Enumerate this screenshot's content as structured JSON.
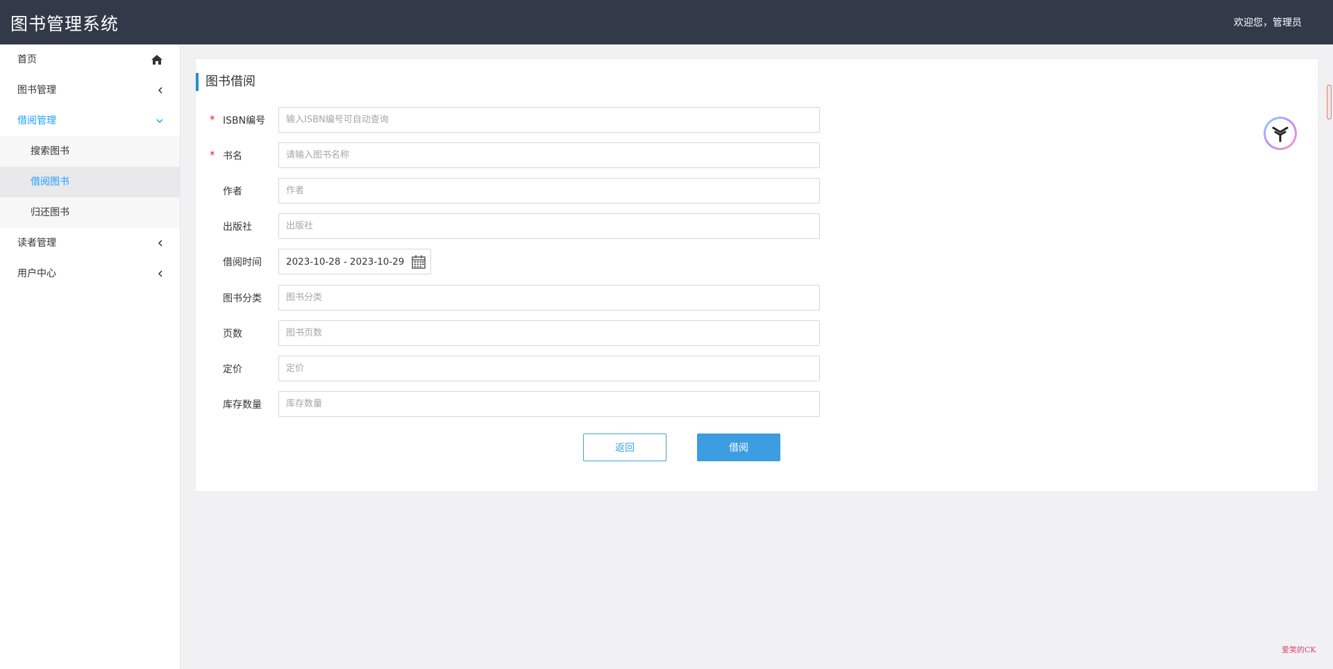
{
  "header": {
    "title": "图书管理系统",
    "welcome": "欢迎您，管理员"
  },
  "sidebar": {
    "items": [
      {
        "label": "首页",
        "icon": "home-icon"
      },
      {
        "label": "图书管理",
        "icon": "chevron-left-icon"
      },
      {
        "label": "借阅管理",
        "icon": "chevron-down-icon",
        "active": true,
        "children": [
          {
            "label": "搜索图书"
          },
          {
            "label": "借阅图书",
            "selected": true
          },
          {
            "label": "归还图书"
          }
        ]
      },
      {
        "label": "读者管理",
        "icon": "chevron-left-icon"
      },
      {
        "label": "用户中心",
        "icon": "chevron-left-icon"
      }
    ]
  },
  "panel": {
    "title": "图书借阅"
  },
  "form": {
    "isbn": {
      "label": "ISBN编号",
      "required": true,
      "placeholder": "输入ISBN编号可自动查询",
      "value": ""
    },
    "name": {
      "label": "书名",
      "required": true,
      "placeholder": "请输入图书名称",
      "value": ""
    },
    "author": {
      "label": "作者",
      "placeholder": "作者",
      "value": ""
    },
    "publisher": {
      "label": "出版社",
      "placeholder": "出版社",
      "value": ""
    },
    "borrow_time": {
      "label": "借阅时间",
      "value": "2023-10-28 - 2023-10-29",
      "icon": "calendar-icon"
    },
    "category": {
      "label": "图书分类",
      "placeholder": "图书分类",
      "value": ""
    },
    "pages": {
      "label": "页数",
      "placeholder": "图书页数",
      "value": ""
    },
    "price": {
      "label": "定价",
      "placeholder": "定价",
      "value": ""
    },
    "stock": {
      "label": "库存数量",
      "placeholder": "库存数量",
      "value": ""
    },
    "required_mark": "*"
  },
  "buttons": {
    "back_label": "返回",
    "borrow_label": "借阅"
  },
  "colors": {
    "header_bg": "#323a49",
    "accent": "#1e9fff",
    "primary_button": "#3c9de0",
    "required": "#e02020"
  },
  "watermark": "爱笑的CK"
}
